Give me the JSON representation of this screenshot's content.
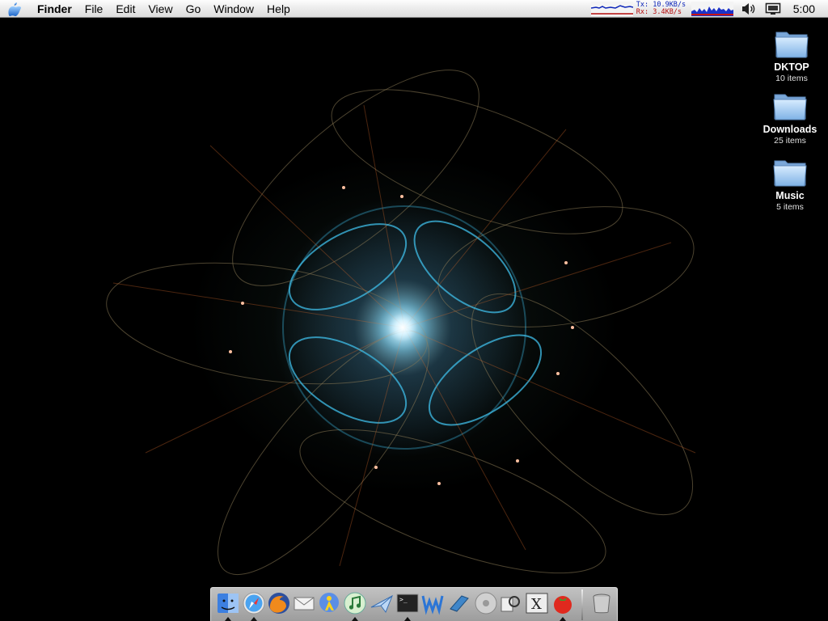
{
  "menubar": {
    "apple_icon": "apple-logo-icon",
    "app_name": "Finder",
    "items": [
      "File",
      "Edit",
      "View",
      "Go",
      "Window",
      "Help"
    ],
    "network": {
      "tx_label": "Tx:  10.9KB/s",
      "rx_label": "Rx:   3.4KB/s"
    },
    "volume_icon": "speaker-icon",
    "display_icon": "display-icon",
    "clock": "5:00"
  },
  "desktop_icons": [
    {
      "name": "DKTOP",
      "count": "10 items",
      "icon": "folder-icon"
    },
    {
      "name": "Downloads",
      "count": "25 items",
      "icon": "folder-icon"
    },
    {
      "name": "Music",
      "count": "5 items",
      "icon": "folder-icon"
    }
  ],
  "dock": {
    "apps": [
      {
        "icon": "finder-icon",
        "running": true
      },
      {
        "icon": "safari-icon",
        "running": true
      },
      {
        "icon": "firefox-icon",
        "running": false
      },
      {
        "icon": "mail-icon",
        "running": false
      },
      {
        "icon": "aim-chat-icon",
        "running": false
      },
      {
        "icon": "itunes-icon",
        "running": true
      },
      {
        "icon": "mail-plane-icon",
        "running": false
      },
      {
        "icon": "terminal-icon",
        "running": true
      },
      {
        "icon": "text-editor-icon",
        "running": false
      },
      {
        "icon": "book-icon",
        "running": false
      },
      {
        "icon": "disc-utility-icon",
        "running": false
      },
      {
        "icon": "preview-icon",
        "running": false
      },
      {
        "icon": "x11-icon",
        "running": false
      },
      {
        "icon": "tomato-icon",
        "running": true
      }
    ],
    "trash_icon": "trash-icon"
  },
  "colors": {
    "menubar": "#ececec",
    "tx": "#0b24b8",
    "rx": "#b40b0b",
    "folder": "#9ec7ee",
    "glow": "#5fd0ff"
  }
}
